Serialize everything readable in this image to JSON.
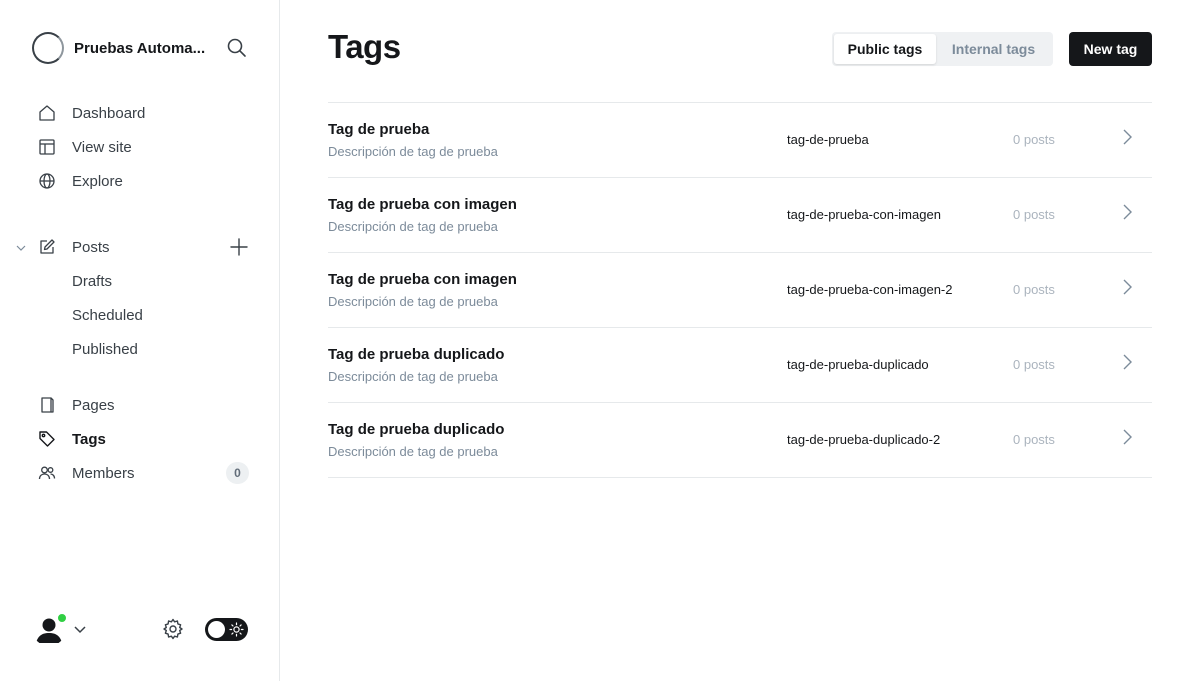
{
  "sidebar": {
    "site_title": "Pruebas Automa...",
    "nav": [
      {
        "label": "Dashboard",
        "icon": "home-icon"
      },
      {
        "label": "View site",
        "icon": "layout-icon"
      },
      {
        "label": "Explore",
        "icon": "globe-icon"
      }
    ],
    "posts": {
      "label": "Posts",
      "icon": "pencil-square-icon",
      "sub": [
        "Drafts",
        "Scheduled",
        "Published"
      ]
    },
    "nav2": [
      {
        "label": "Pages",
        "icon": "page-icon"
      },
      {
        "label": "Tags",
        "icon": "tag-icon",
        "active": true
      },
      {
        "label": "Members",
        "icon": "users-icon",
        "badge": "0"
      }
    ]
  },
  "header": {
    "title": "Tags",
    "tabs": [
      "Public tags",
      "Internal tags"
    ],
    "active_tab": "Public tags",
    "new_button": "New tag"
  },
  "tags": [
    {
      "name": "Tag de prueba",
      "description": "Descripción de tag de prueba",
      "slug": "tag-de-prueba",
      "count": "0 posts"
    },
    {
      "name": "Tag de prueba con imagen",
      "description": "Descripción de tag de prueba",
      "slug": "tag-de-prueba-con-imagen",
      "count": "0 posts"
    },
    {
      "name": "Tag de prueba con imagen",
      "description": "Descripción de tag de prueba",
      "slug": "tag-de-prueba-con-imagen-2",
      "count": "0 posts"
    },
    {
      "name": "Tag de prueba duplicado",
      "description": "Descripción de tag de prueba",
      "slug": "tag-de-prueba-duplicado",
      "count": "0 posts"
    },
    {
      "name": "Tag de prueba duplicado",
      "description": "Descripción de tag de prueba",
      "slug": "tag-de-prueba-duplicado-2",
      "count": "0 posts"
    }
  ],
  "colors": {
    "accent": "#15171a",
    "online": "#30cf43",
    "muted": "#7c8b9a",
    "border": "#e6e9eb"
  }
}
